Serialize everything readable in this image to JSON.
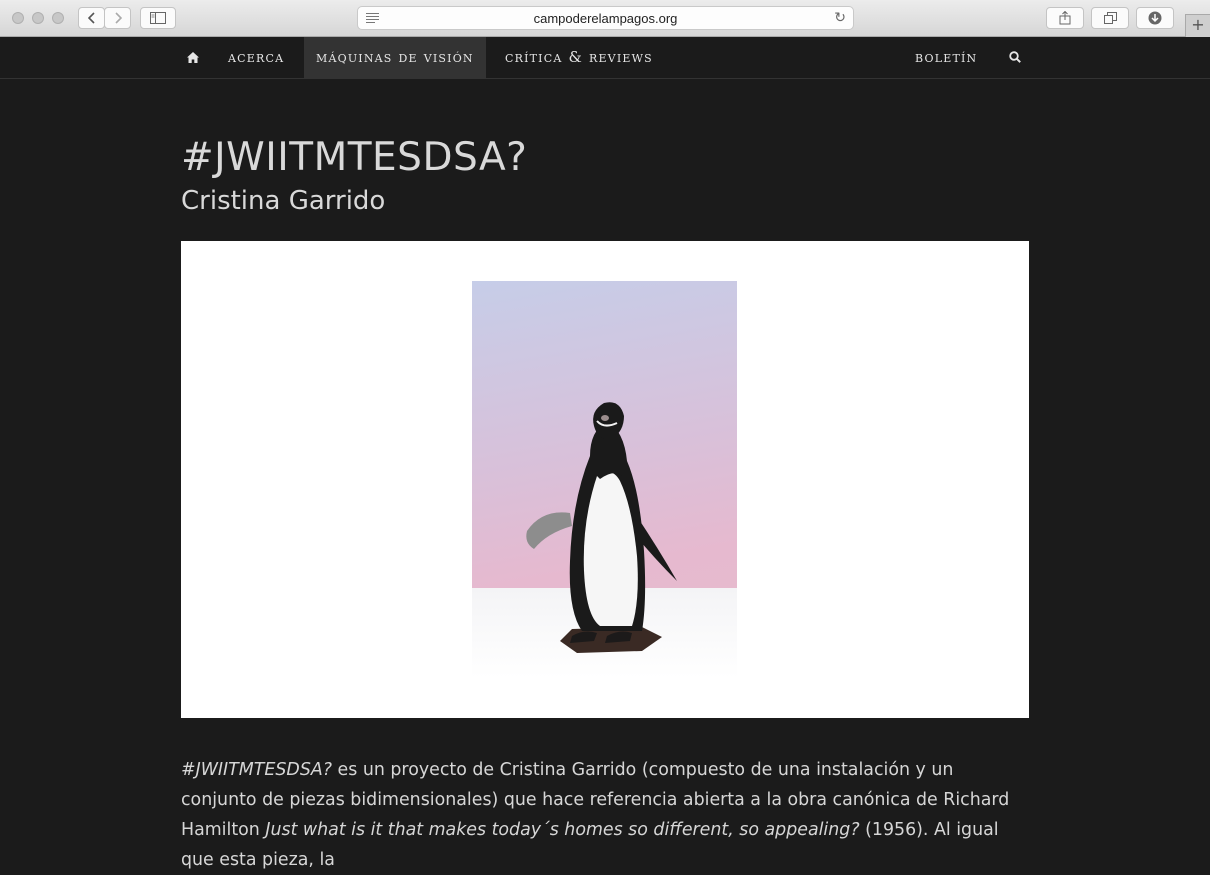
{
  "browser": {
    "url": "campoderelampagos.org",
    "new_tab_glyph": "+"
  },
  "nav": {
    "acerca": "Acerca",
    "maquinas": "Máquinas de Visión",
    "critica": "Crítica & Reviews",
    "boletin": "Boletín"
  },
  "article": {
    "title": "#JWIITMTESDSA?",
    "author": "Cristina Garrido",
    "p1_italic": "#JWIITMTESDSA?",
    "p1_text": " es un proyecto de Cristina Garrido (compuesto de una instalación y un conjunto de piezas bidimensionales) que hace referencia abierta a la obra canónica de Richard Hamilton ",
    "p1_italic2": "Just what is it that makes today´s homes so different, so appealing?",
    "p1_text2": " (1956). Al igual que esta pieza, la"
  },
  "colors": {
    "page_bg": "#1b1b1b",
    "active_nav_bg": "#333333",
    "text": "#d9d9d9"
  },
  "icons": [
    "home-icon",
    "search-icon",
    "back-icon",
    "forward-icon",
    "sidebar-icon",
    "reader-icon",
    "reload-icon",
    "share-icon",
    "tabs-icon",
    "download-icon"
  ]
}
